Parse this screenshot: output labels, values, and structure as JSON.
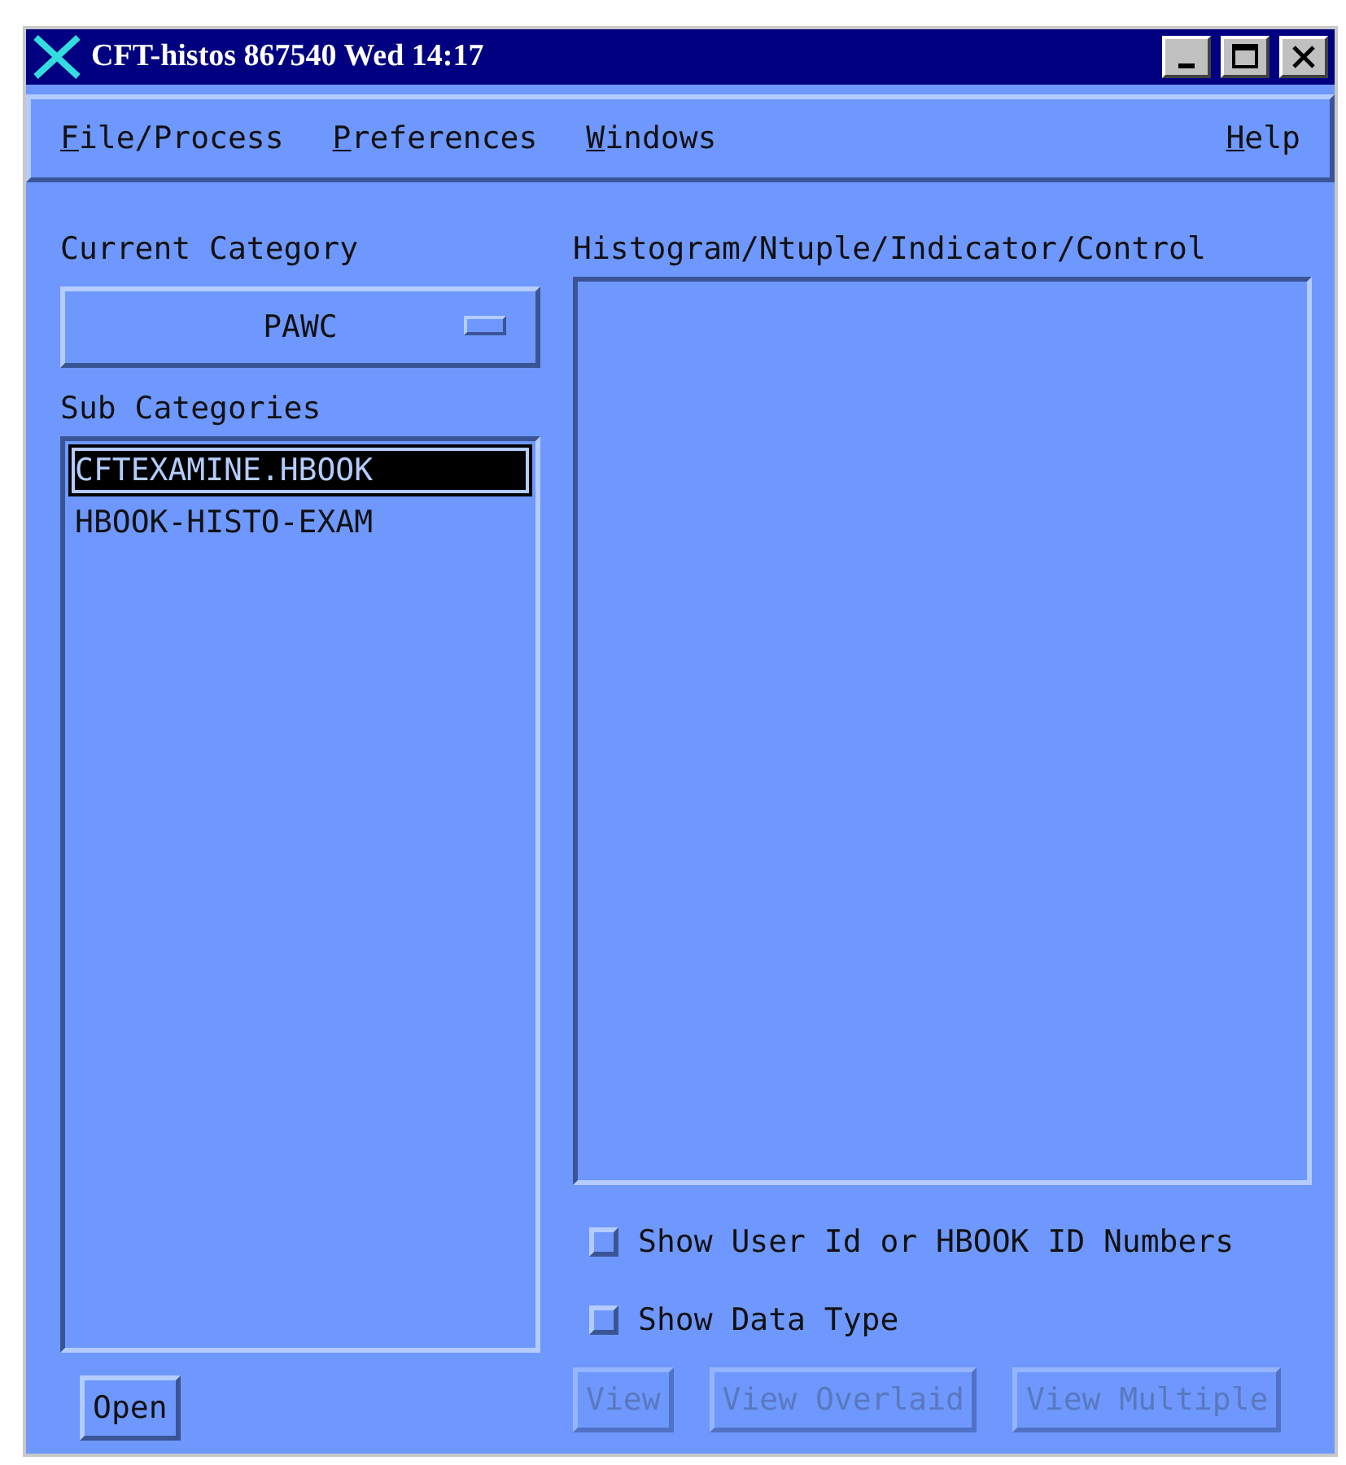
{
  "window": {
    "title": "CFT-histos 867540 Wed 14:17"
  },
  "menu": [
    {
      "label": "File/Process"
    },
    {
      "label": "Preferences"
    },
    {
      "label": "Windows"
    },
    {
      "label": "Help",
      "kind": "help"
    }
  ],
  "current_category": {
    "label": "Current Category",
    "value": "PAWC"
  },
  "sub_categories": {
    "label": "Sub Categories",
    "items": [
      {
        "label": "CFTEXAMINE.HBOOK",
        "selected": true
      },
      {
        "label": "HBOOK-HISTO-EXAM",
        "selected": false
      }
    ]
  },
  "open_button": {
    "label": "Open",
    "disabled": false
  },
  "objects": {
    "label": "Histogram/Ntuple/Indicator/Control"
  },
  "options": [
    {
      "label": "Show User Id or HBOOK ID Numbers",
      "checked": false
    },
    {
      "label": "Show Data Type",
      "checked": false
    }
  ],
  "buttons": [
    {
      "label": "View",
      "disabled": true
    },
    {
      "label": "View Overlaid",
      "disabled": true
    },
    {
      "label": "View Multiple",
      "disabled": true
    }
  ]
}
